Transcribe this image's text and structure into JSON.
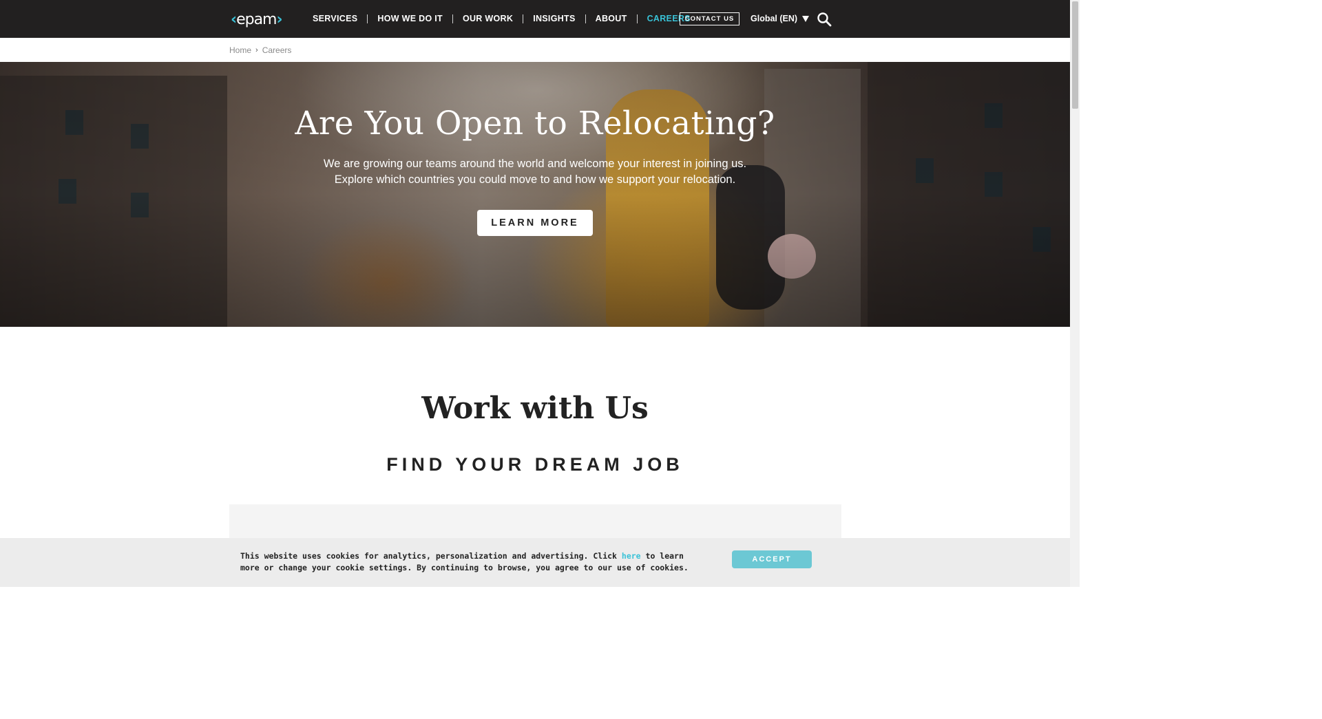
{
  "header": {
    "logo_text": "epam",
    "nav": [
      {
        "label": "SERVICES",
        "active": false
      },
      {
        "label": "HOW WE DO IT",
        "active": false
      },
      {
        "label": "OUR WORK",
        "active": false
      },
      {
        "label": "INSIGHTS",
        "active": false
      },
      {
        "label": "ABOUT",
        "active": false
      },
      {
        "label": "CAREERS",
        "active": true
      }
    ],
    "contact_label": "CONTACT US",
    "language": "Global (EN)",
    "search_icon": "search-icon"
  },
  "breadcrumb": {
    "items": [
      "Home",
      "Careers"
    ],
    "separator": "›"
  },
  "hero": {
    "title": "Are You Open to Relocating?",
    "text_line1": "We are growing our teams around the world and welcome your interest in joining us.",
    "text_line2": "Explore which countries you could move to and how we support your relocation.",
    "button_label": "LEARN MORE"
  },
  "main": {
    "title": "Work with Us",
    "subtitle": "FIND YOUR DREAM JOB"
  },
  "cookie": {
    "text_before": "This website uses cookies for analytics, personalization and advertising. Click ",
    "link": "here",
    "text_after": " to learn more or change your cookie settings. By continuing to browse, you agree to our use of cookies.",
    "accept_label": "ACCEPT"
  },
  "colors": {
    "header_bg": "#222020",
    "accent": "#39c2d7",
    "accept_bg": "#6cc8d4",
    "cookie_bg": "#ececec"
  }
}
